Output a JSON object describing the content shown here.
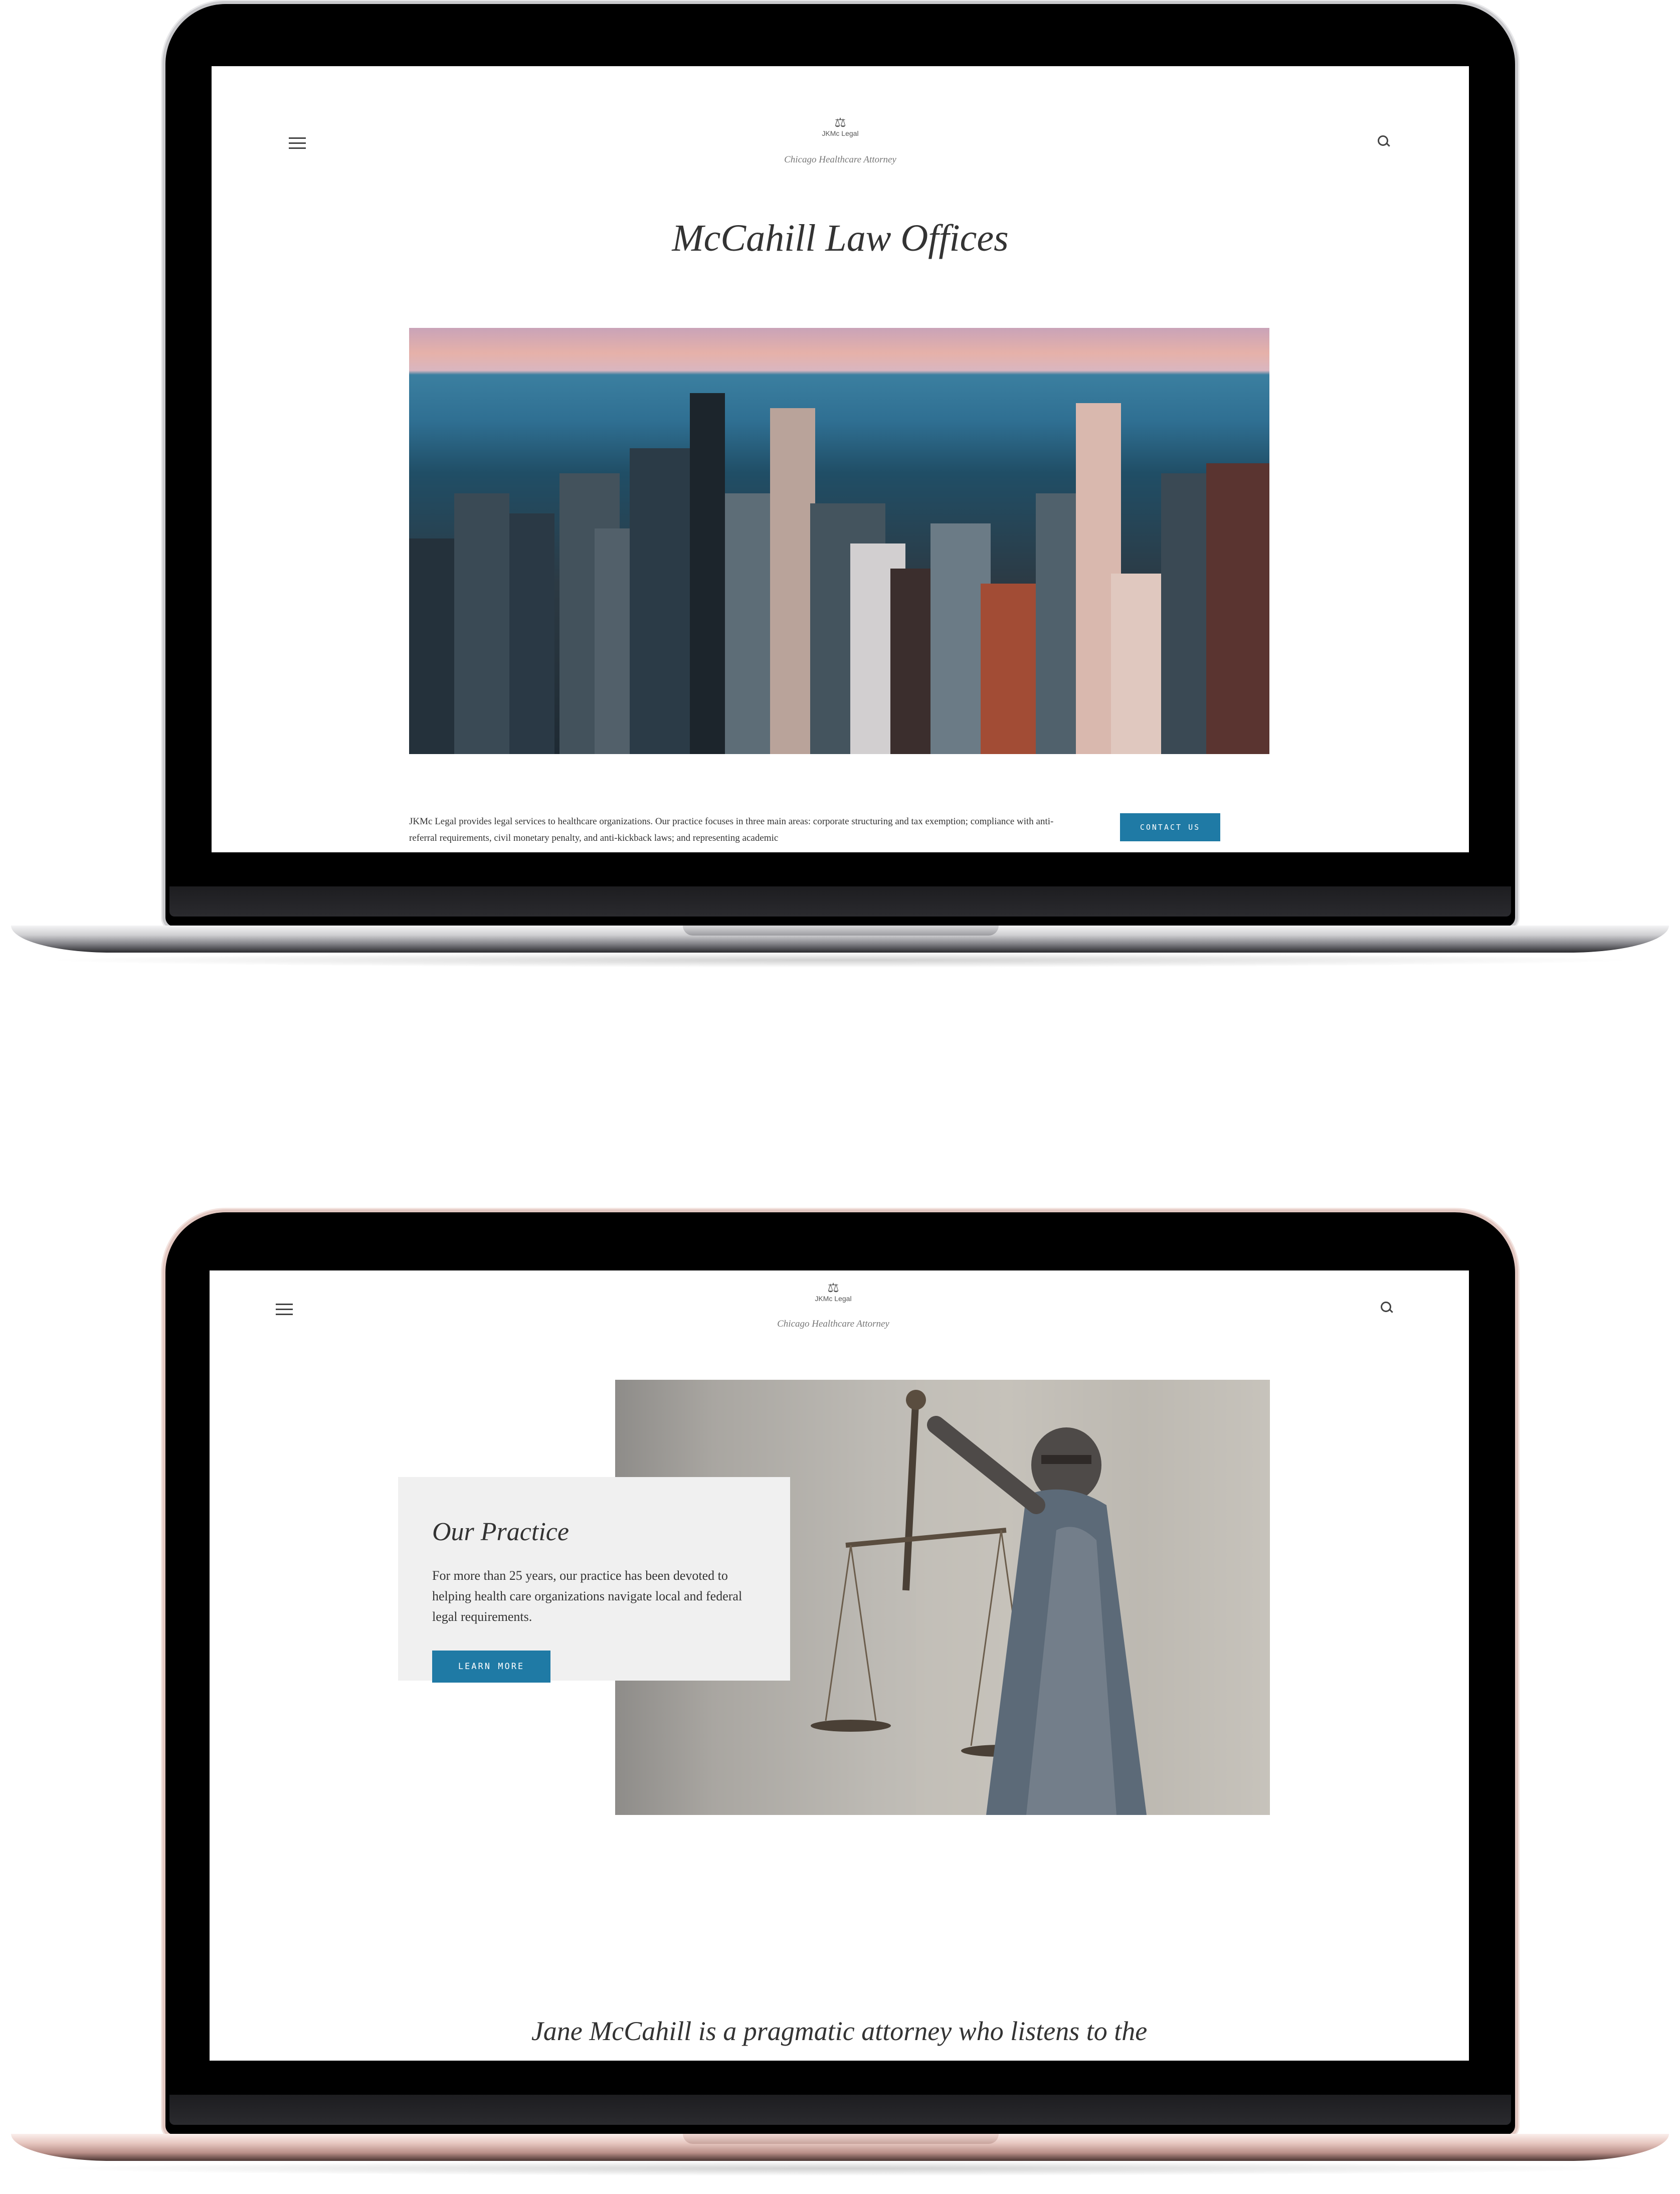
{
  "home": {
    "logo_text": "JKMc Legal",
    "tagline": "Chicago Healthcare Attorney",
    "title": "McCahill Law Offices",
    "intro": "JKMc Legal provides legal services to healthcare organizations. Our practice focuses in three main areas: corporate structuring and tax exemption; compliance with anti-referral requirements, civil monetary penalty, and anti-kickback laws; and representing academic",
    "contact_label": "CONTACT US"
  },
  "practice": {
    "logo_text": "JKMc Legal",
    "tagline": "Chicago Healthcare Attorney",
    "card_title": "Our Practice",
    "card_text": "For more than 25 years, our practice has been devoted to helping health care organizations navigate local and federal legal requirements.",
    "learn_label": "LEARN MORE",
    "quote": "Jane McCahill is a pragmatic attorney who listens to the"
  },
  "icons": {
    "menu": "menu-icon",
    "search": "search-icon",
    "logo": "scales-logo-icon"
  },
  "colors": {
    "accent": "#1f7aa5"
  }
}
